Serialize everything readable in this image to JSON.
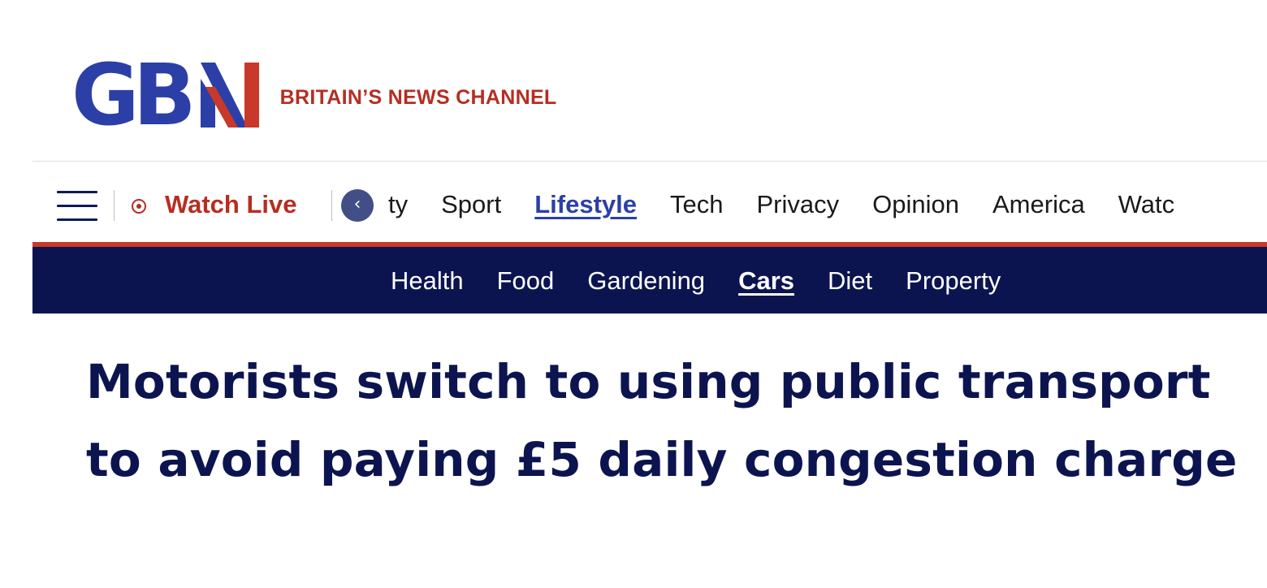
{
  "brand": {
    "logo_text": "GBN",
    "logo_letters": "GB",
    "tagline": "BRITAIN’S NEWS CHANNEL",
    "colors": {
      "blue": "#2c3fa6",
      "red": "#b52e22",
      "navy": "#0c1450"
    }
  },
  "nav": {
    "menu_icon": "hamburger-menu-icon",
    "live_icon": "live-dot-icon",
    "watch_live_label": "Watch Live",
    "scroll_icon": "chevron-left-icon",
    "items": [
      {
        "label": "ty",
        "active": false
      },
      {
        "label": "Sport",
        "active": false
      },
      {
        "label": "Lifestyle",
        "active": true
      },
      {
        "label": "Tech",
        "active": false
      },
      {
        "label": "Privacy",
        "active": false
      },
      {
        "label": "Opinion",
        "active": false
      },
      {
        "label": "America",
        "active": false
      },
      {
        "label": "Watc",
        "active": false
      }
    ]
  },
  "subnav": {
    "items": [
      {
        "label": "Health",
        "active": false
      },
      {
        "label": "Food",
        "active": false
      },
      {
        "label": "Gardening",
        "active": false
      },
      {
        "label": "Cars",
        "active": true
      },
      {
        "label": "Diet",
        "active": false
      },
      {
        "label": "Property",
        "active": false
      }
    ]
  },
  "article": {
    "headline": "Motorists switch to using public transport to avoid paying £5 daily congestion charge"
  }
}
